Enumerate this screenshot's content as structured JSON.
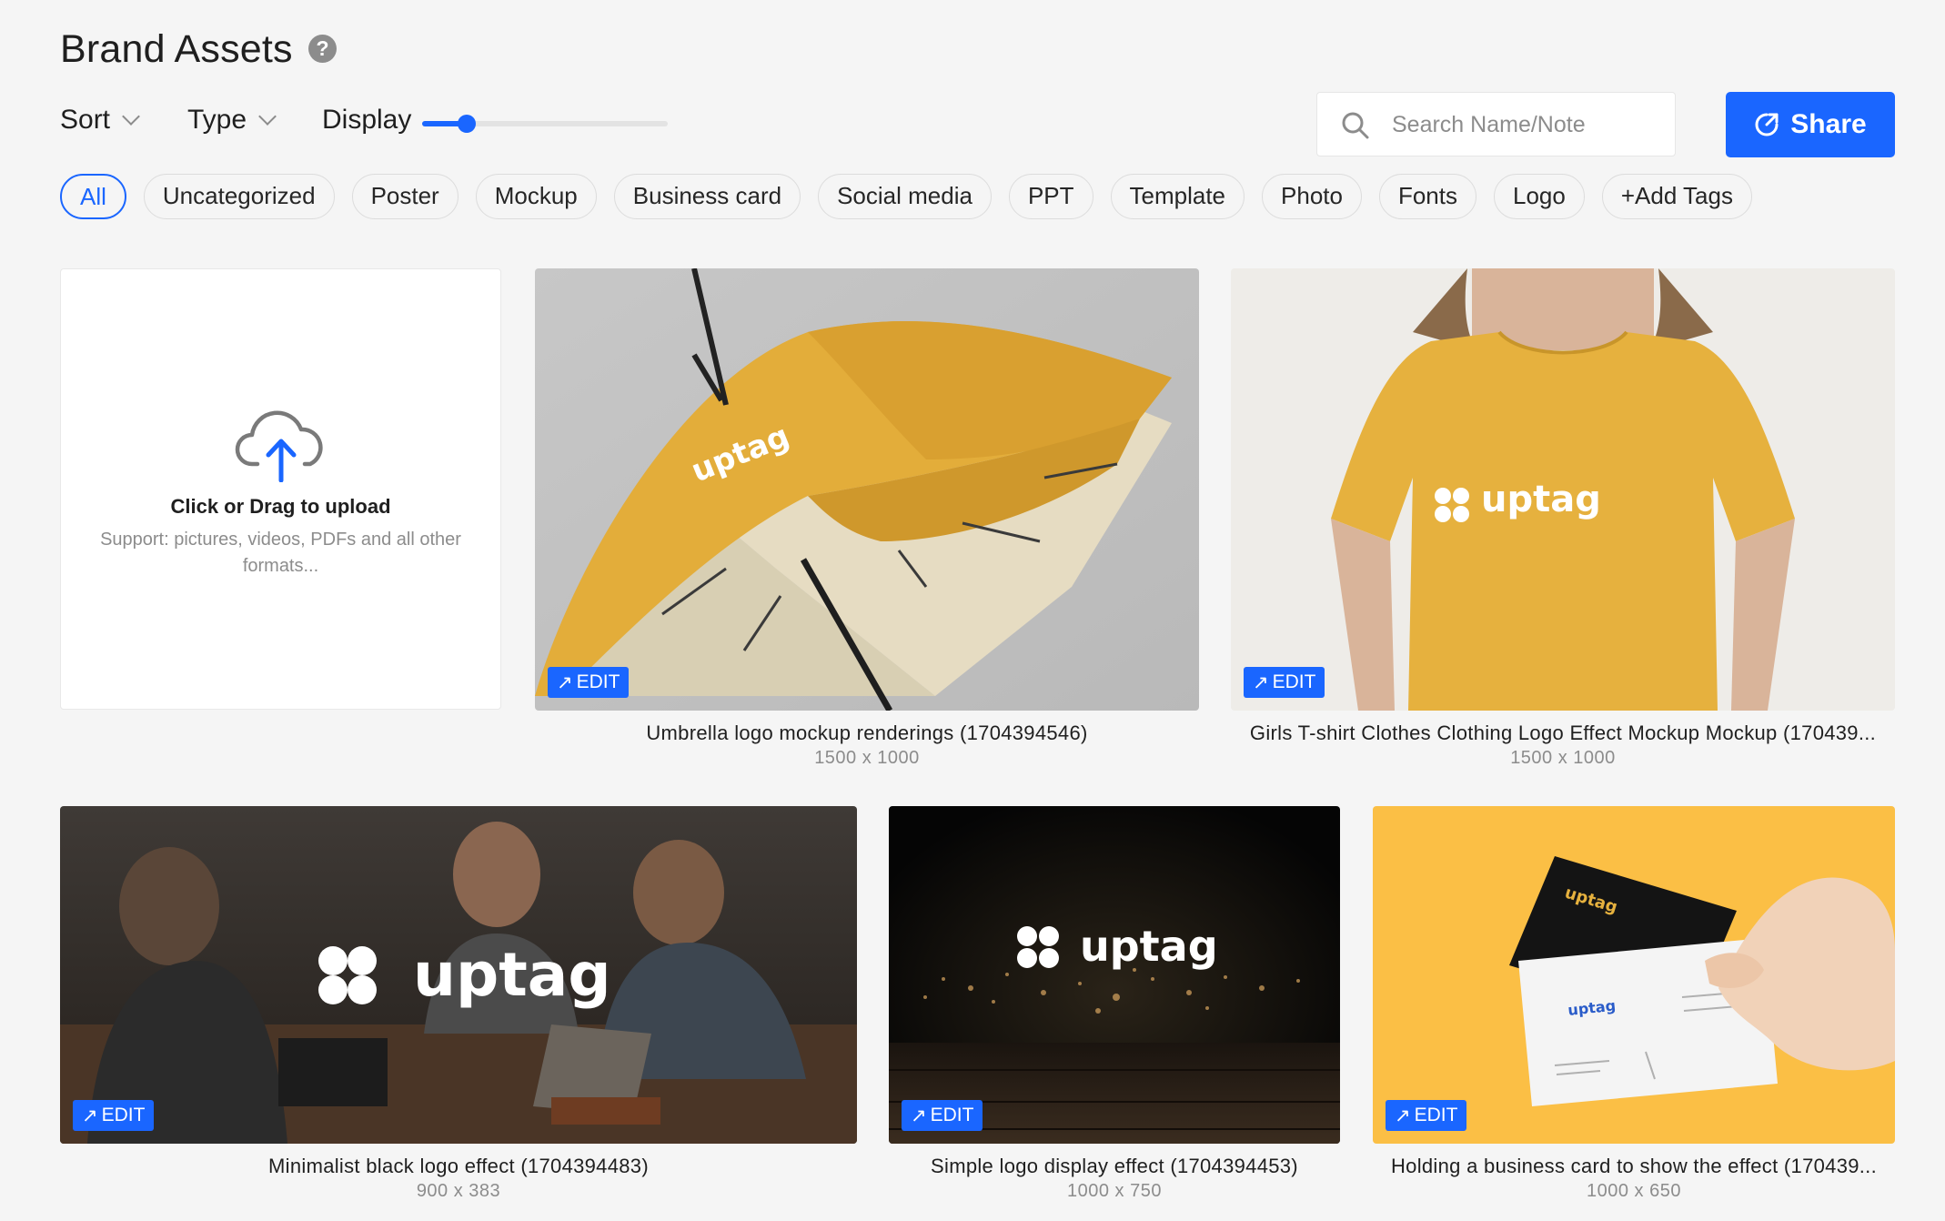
{
  "header": {
    "title": "Brand Assets",
    "help_icon": "question-circle-icon",
    "sort_label": "Sort",
    "type_label": "Type",
    "display_label": "Display",
    "display_level": 0.18
  },
  "search": {
    "placeholder": "Search Name/Note",
    "value": ""
  },
  "share": {
    "label": "Share",
    "icon": "share-icon"
  },
  "tags": [
    "All",
    "Uncategorized",
    "Poster",
    "Mockup",
    "Business card",
    "Social media",
    "PPT",
    "Template",
    "Photo",
    "Fonts",
    "Logo",
    "+Add Tags"
  ],
  "active_tag": "All",
  "upload": {
    "title": "Click or Drag to upload",
    "subtitle": "Support: pictures, videos, PDFs and all other formats...",
    "icon": "cloud-upload-icon"
  },
  "edit_label": "EDIT",
  "assets": [
    {
      "name": "Umbrella logo mockup renderings (1704394546)",
      "size": "1500 x 1000",
      "logo": "uptag"
    },
    {
      "name": "Girls T-shirt Clothes Clothing Logo Effect Mockup Mockup (170439...",
      "size": "1500 x 1000",
      "logo": "uptag"
    },
    {
      "name": "Minimalist black logo effect (1704394483)",
      "size": "900 x 383",
      "logo": "uptag"
    },
    {
      "name": "Simple logo display effect (1704394453)",
      "size": "1000 x 750",
      "logo": "uptag"
    },
    {
      "name": "Holding a business card to show the effect (170439...",
      "size": "1000 x 650",
      "logo": "uptag"
    }
  ],
  "colors": {
    "accent": "#1a66ff",
    "mustard": "#e3ad3a",
    "yellow_bg": "#fbbf45"
  }
}
